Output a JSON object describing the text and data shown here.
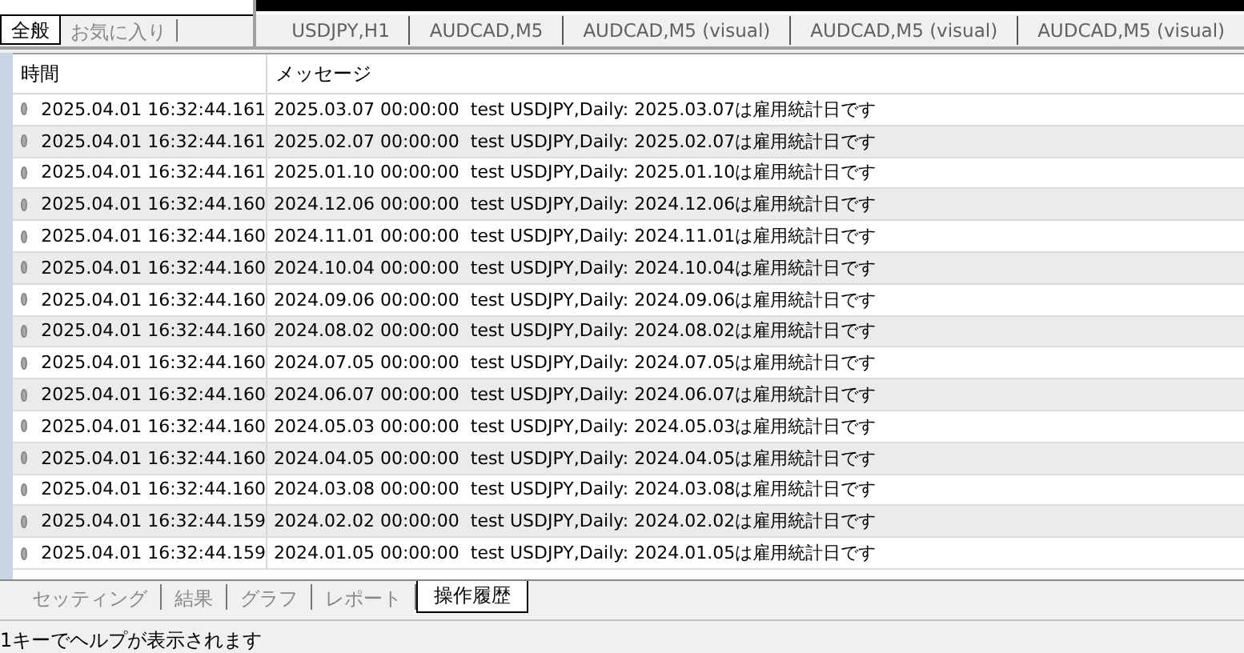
{
  "navigator_tabs": [
    {
      "label": "全般",
      "selected": true
    },
    {
      "label": "お気に入り",
      "selected": false
    }
  ],
  "chart_tabs": [
    {
      "label": "USDJPY,H1"
    },
    {
      "label": "AUDCAD,M5"
    },
    {
      "label": "AUDCAD,M5 (visual)"
    },
    {
      "label": "AUDCAD,M5 (visual)"
    },
    {
      "label": "AUDCAD,M5 (visual)"
    }
  ],
  "table": {
    "columns": [
      "時間",
      "メッセージ"
    ],
    "rows": [
      {
        "time": "2025.04.01 16:32:44.161",
        "message": "2025.03.07 00:00:00  test USDJPY,Daily: 2025.03.07は雇用統計日です"
      },
      {
        "time": "2025.04.01 16:32:44.161",
        "message": "2025.02.07 00:00:00  test USDJPY,Daily: 2025.02.07は雇用統計日です"
      },
      {
        "time": "2025.04.01 16:32:44.161",
        "message": "2025.01.10 00:00:00  test USDJPY,Daily: 2025.01.10は雇用統計日です"
      },
      {
        "time": "2025.04.01 16:32:44.160",
        "message": "2024.12.06 00:00:00  test USDJPY,Daily: 2024.12.06は雇用統計日です"
      },
      {
        "time": "2025.04.01 16:32:44.160",
        "message": "2024.11.01 00:00:00  test USDJPY,Daily: 2024.11.01は雇用統計日です"
      },
      {
        "time": "2025.04.01 16:32:44.160",
        "message": "2024.10.04 00:00:00  test USDJPY,Daily: 2024.10.04は雇用統計日です"
      },
      {
        "time": "2025.04.01 16:32:44.160",
        "message": "2024.09.06 00:00:00  test USDJPY,Daily: 2024.09.06は雇用統計日です"
      },
      {
        "time": "2025.04.01 16:32:44.160",
        "message": "2024.08.02 00:00:00  test USDJPY,Daily: 2024.08.02は雇用統計日です"
      },
      {
        "time": "2025.04.01 16:32:44.160",
        "message": "2024.07.05 00:00:00  test USDJPY,Daily: 2024.07.05は雇用統計日です"
      },
      {
        "time": "2025.04.01 16:32:44.160",
        "message": "2024.06.07 00:00:00  test USDJPY,Daily: 2024.06.07は雇用統計日です"
      },
      {
        "time": "2025.04.01 16:32:44.160",
        "message": "2024.05.03 00:00:00  test USDJPY,Daily: 2024.05.03は雇用統計日です"
      },
      {
        "time": "2025.04.01 16:32:44.160",
        "message": "2024.04.05 00:00:00  test USDJPY,Daily: 2024.04.05は雇用統計日です"
      },
      {
        "time": "2025.04.01 16:32:44.160",
        "message": "2024.03.08 00:00:00  test USDJPY,Daily: 2024.03.08は雇用統計日です"
      },
      {
        "time": "2025.04.01 16:32:44.159",
        "message": "2024.02.02 00:00:00  test USDJPY,Daily: 2024.02.02は雇用統計日です"
      },
      {
        "time": "2025.04.01 16:32:44.159",
        "message": "2024.01.05 00:00:00  test USDJPY,Daily: 2024.01.05は雇用統計日です"
      }
    ]
  },
  "bottom_tabs": [
    {
      "label": "セッティング",
      "selected": false
    },
    {
      "label": "結果",
      "selected": false
    },
    {
      "label": "グラフ",
      "selected": false
    },
    {
      "label": "レポート",
      "selected": false
    },
    {
      "label": "操作履歴",
      "selected": true
    }
  ],
  "status_bar": "1キーでヘルプが表示されます"
}
